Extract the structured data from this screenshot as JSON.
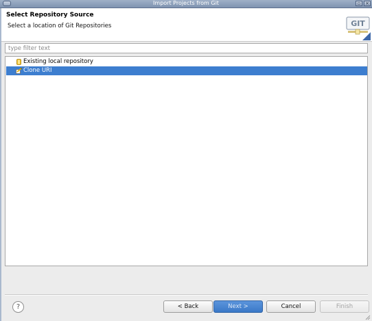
{
  "window": {
    "title": "Import Projects from Git"
  },
  "header": {
    "heading": "Select Repository Source",
    "subheading": "Select a location of Git Repositories",
    "logo_text": "GIT"
  },
  "filter": {
    "placeholder": "type filter text",
    "value": ""
  },
  "tree": {
    "items": [
      {
        "label": "Existing local repository",
        "icon": "repository-icon",
        "selected": false
      },
      {
        "label": "Clone URI",
        "icon": "clone-uri-icon",
        "selected": true
      }
    ]
  },
  "buttons": {
    "help": "?",
    "back": "< Back",
    "next": "Next >",
    "cancel": "Cancel",
    "finish": "Finish"
  },
  "colors": {
    "selection": "#3d7ecf",
    "titlebar": "#8fa2bd"
  }
}
